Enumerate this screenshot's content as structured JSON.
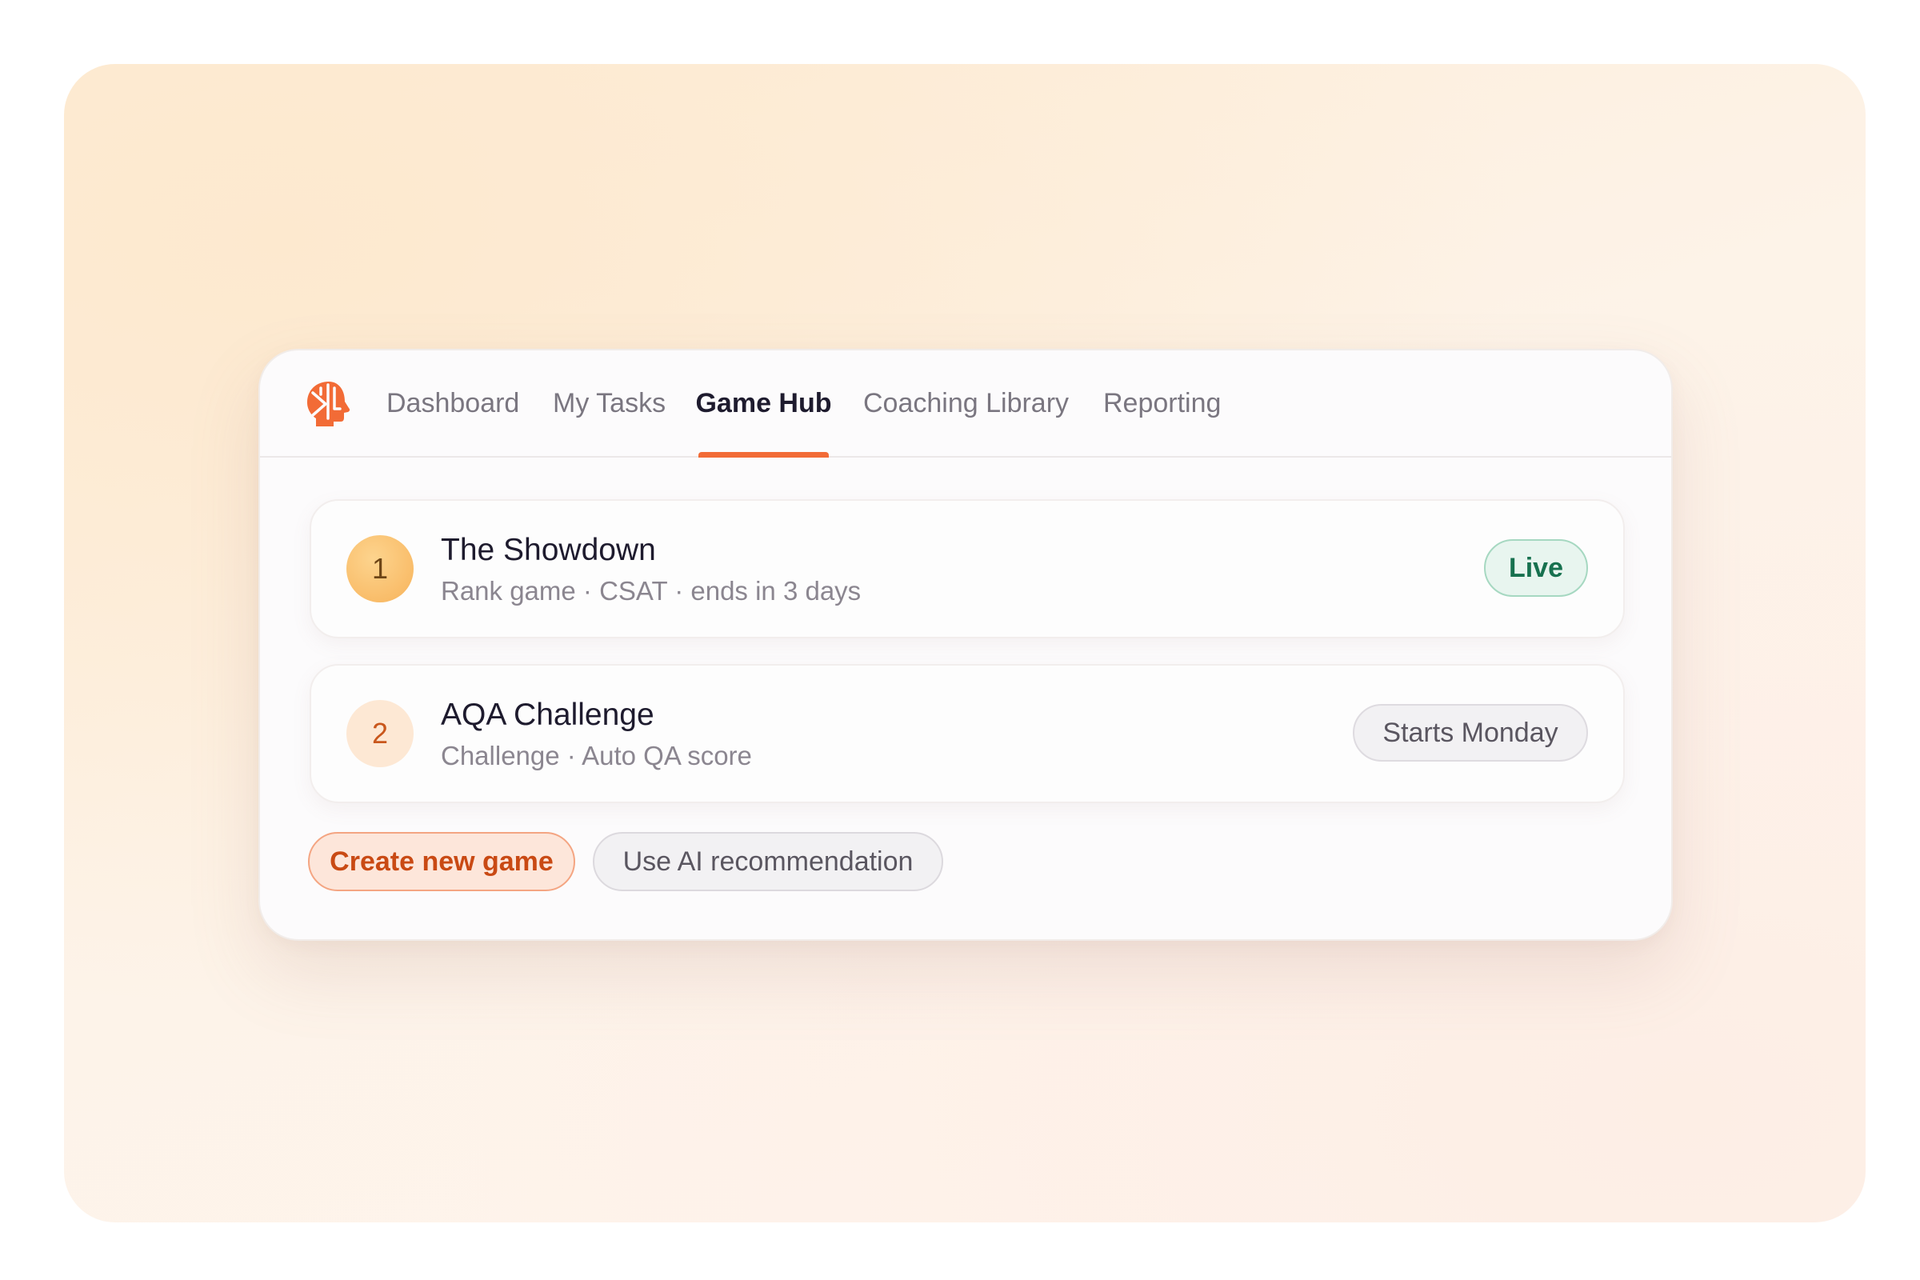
{
  "nav": {
    "logo_icon": "brain-head-icon",
    "tabs": [
      {
        "label": "Dashboard",
        "active": false
      },
      {
        "label": "My Tasks",
        "active": false
      },
      {
        "label": "Game Hub",
        "active": true
      },
      {
        "label": "Coaching Library",
        "active": false
      },
      {
        "label": "Reporting",
        "active": false
      }
    ]
  },
  "games": [
    {
      "rank": "1",
      "title": "The Showdown",
      "subtitle": "Rank game · CSAT · ends in 3 days",
      "status": "Live"
    },
    {
      "rank": "2",
      "title": "AQA Challenge",
      "subtitle": "Challenge · Auto QA score",
      "status": "Starts Monday"
    }
  ],
  "actions": {
    "create_label": "Create new game",
    "ai_label": "Use AI recommendation"
  },
  "colors": {
    "accent": "#f26b36",
    "live_text": "#17714f",
    "live_bg": "#e8f5ef"
  }
}
